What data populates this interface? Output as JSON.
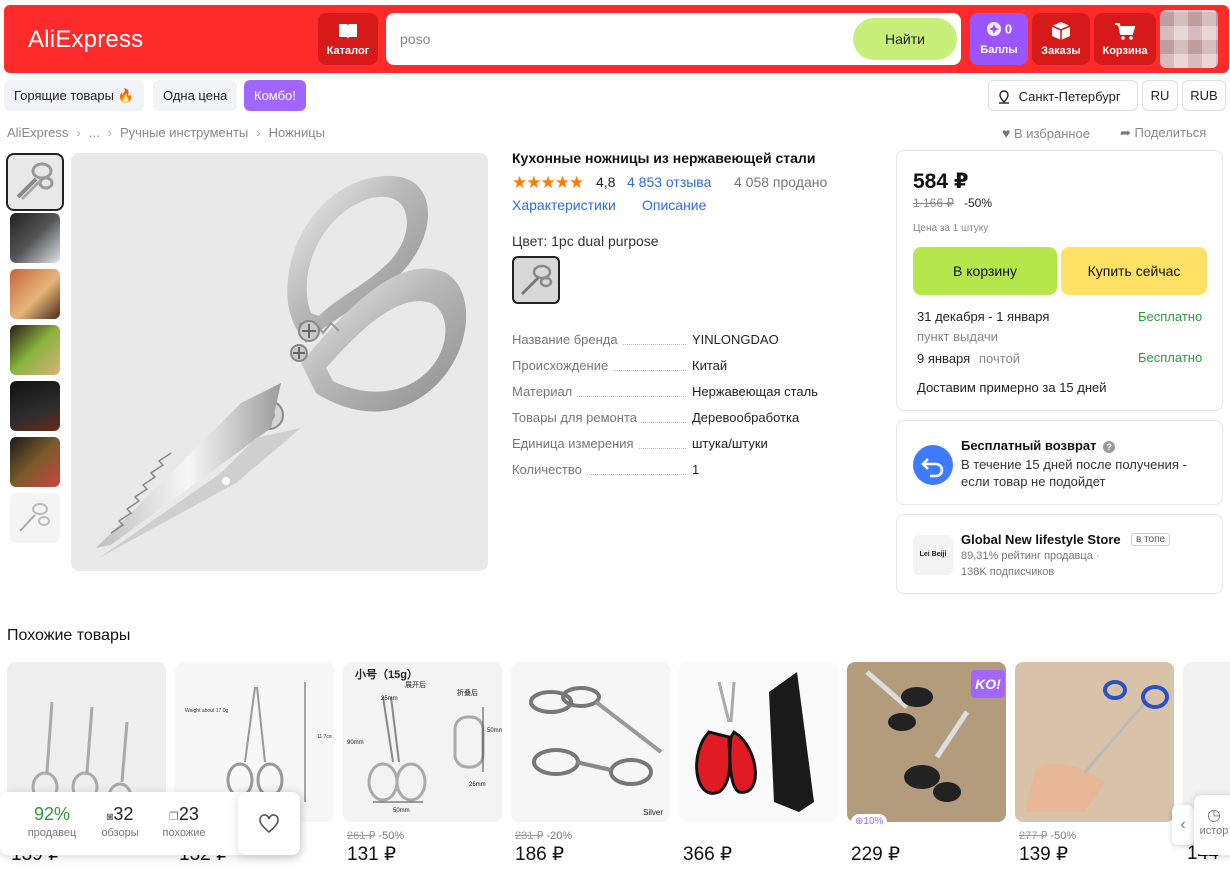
{
  "header": {
    "logo": "AliExpress",
    "catalog_label": "Каталог",
    "search_value": "poso",
    "search_button": "Найти",
    "points_count": "0",
    "points_label": "Баллы",
    "orders_label": "Заказы",
    "cart_label": "Корзина",
    "brand_color": "#ff2b2b"
  },
  "nav_pills": {
    "hot": "Горящие товары",
    "one_price": "Одна цена",
    "combo": "Комбо!",
    "city": "Санкт-Петербург",
    "lang": "RU",
    "currency": "RUB"
  },
  "breadcrumb": {
    "items": [
      "AliExpress",
      "...",
      "Ручные инструменты",
      "Ножницы"
    ],
    "favorite": "В избранное",
    "share": "Поделиться"
  },
  "product": {
    "title": "Кухонные ножницы из нержавеющей стали",
    "stars": "★★★★★",
    "rating": "4,8",
    "reviews": "4 853 отзыва",
    "sold": "4 058 продано",
    "tab_specs": "Характеристики",
    "tab_description": "Описание",
    "color_label": "Цвет: 1pc dual purpose",
    "specs": [
      {
        "key": "Название бренда",
        "value": "YINLONGDAO"
      },
      {
        "key": "Происхождение",
        "value": "Китай"
      },
      {
        "key": "Материал",
        "value": "Нержавеющая сталь"
      },
      {
        "key": "Товары для ремонта",
        "value": "Деревообработка"
      },
      {
        "key": "Единица измерения",
        "value": "штука/штуки"
      },
      {
        "key": "Количество",
        "value": "1"
      }
    ]
  },
  "buy_box": {
    "price": "584 ₽",
    "old_price": "1 166 ₽",
    "discount": "-50%",
    "unit_note": "Цена за 1 штуку",
    "add_to_cart": "В корзину",
    "buy_now": "Купить сейчас",
    "delivery1_date": "31 декабря - 1 января",
    "delivery1_method": "пункт выдачи",
    "delivery1_cost": "Бесплатно",
    "delivery2_date": "9 января",
    "delivery2_method": "почтой",
    "delivery2_cost": "Бесплатно",
    "delivery_eta": "Доставим примерно за 15 дней"
  },
  "returns": {
    "title": "Бесплатный возврат",
    "text_line1": "В течение 15 дней после получения -",
    "text_line2": "если товар не подойдет"
  },
  "store": {
    "logo_text": "Lei Beiji",
    "name": "Global New lifestyle Store",
    "badge": "в топе",
    "rating": "89,31% рейтинг продавца",
    "subscribers": "138K подписчиков"
  },
  "similar": {
    "title": "Похожие товары",
    "items": [
      {
        "old": "",
        "discount": "",
        "price": "139 ₽"
      },
      {
        "old": "",
        "discount": "",
        "price": "132 ₽"
      },
      {
        "old": "261 ₽",
        "discount": "-50%",
        "price": "131 ₽"
      },
      {
        "old": "231 ₽",
        "discount": "-20%",
        "price": "186 ₽"
      },
      {
        "old": "",
        "discount": "",
        "price": "366 ₽"
      },
      {
        "old": "",
        "discount": "",
        "price": "229 ₽"
      },
      {
        "old": "277 ₽",
        "discount": "-50%",
        "price": "139 ₽"
      },
      {
        "old": "",
        "discount": "",
        "price": "144"
      }
    ],
    "img2_caption": "Weight about 17.0g",
    "img2_dim": "11.7ся",
    "img3_title": "小号（15g）",
    "img3_subtitle": "展开后",
    "img3_fold": "折叠后",
    "img3_d1": "25mm",
    "img3_d2": "90mm",
    "img3_d3": "50mm",
    "img3_d4": "50mm",
    "img3_d5": "26mm",
    "img4_label": "Silver",
    "img6_badge": "KO!",
    "img6_bonus": "10%"
  },
  "widget": {
    "seller_pct": "92%",
    "seller_label": "продавец",
    "reviews_count": "32",
    "reviews_label": "обзоры",
    "similar_count": "23",
    "similar_label": "похожие",
    "history_label": "истор"
  }
}
